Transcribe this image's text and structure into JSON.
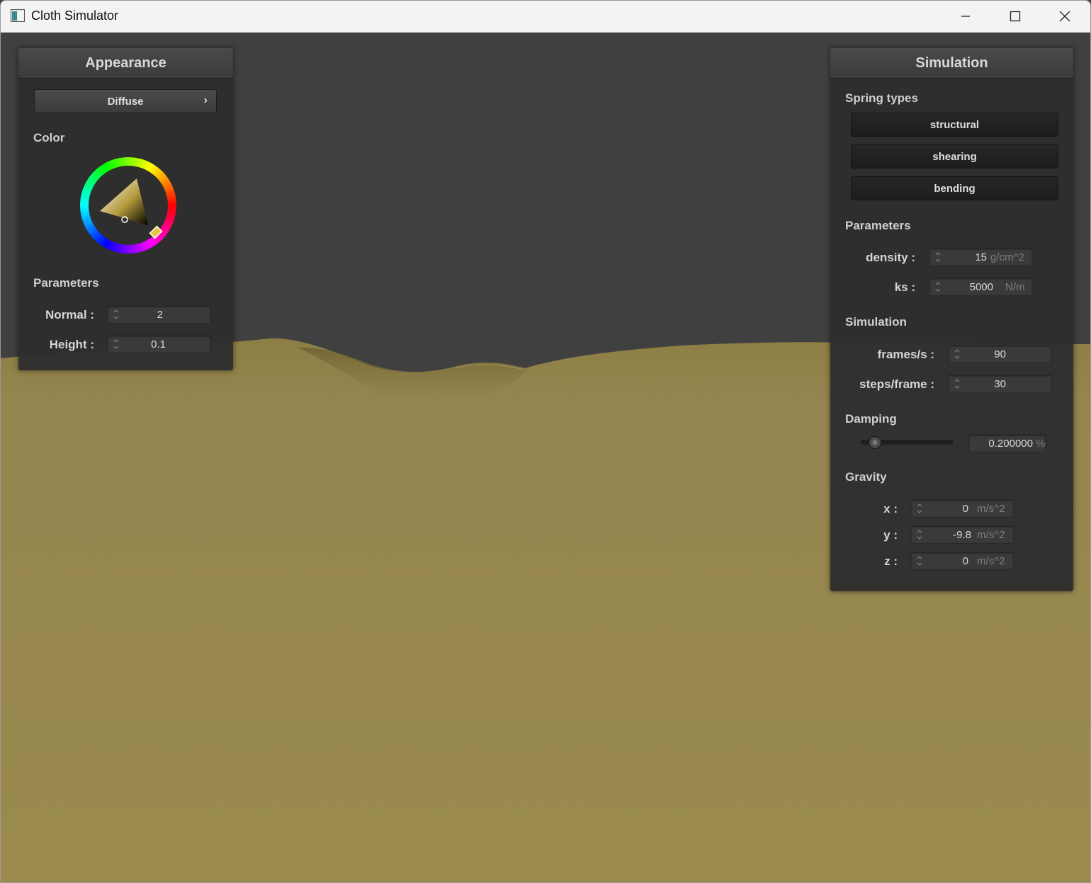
{
  "window": {
    "title": "Cloth Simulator"
  },
  "appearance": {
    "title": "Appearance",
    "shader_dropdown": {
      "value": "Diffuse",
      "arrow": "›"
    },
    "color_label": "Color",
    "color_value": "#9a8a4e",
    "parameters_label": "Parameters",
    "normal": {
      "label": "Normal :",
      "value": "2"
    },
    "height": {
      "label": "Height :",
      "value": "0.1"
    }
  },
  "simulation_panel": {
    "title": "Simulation",
    "spring_types_label": "Spring types",
    "spring_buttons": [
      "structural",
      "shearing",
      "bending"
    ],
    "parameters_label": "Parameters",
    "density": {
      "label": "density :",
      "value": "15",
      "unit": "g/cm^2"
    },
    "ks": {
      "label": "ks :",
      "value": "5000",
      "unit": "N/m"
    },
    "simulation_label": "Simulation",
    "frames_per_s": {
      "label": "frames/s :",
      "value": "90"
    },
    "steps_per_frame": {
      "label": "steps/frame :",
      "value": "30"
    },
    "damping_label": "Damping",
    "damping": {
      "value": "0.200000",
      "unit": "%",
      "slider_fraction": 0.1
    },
    "gravity_label": "Gravity",
    "gravity_x": {
      "label": "x :",
      "value": "0",
      "unit": "m/s^2"
    },
    "gravity_y": {
      "label": "y :",
      "value": "-9.8",
      "unit": "m/s^2"
    },
    "gravity_z": {
      "label": "z :",
      "value": "0",
      "unit": "m/s^2"
    }
  },
  "colors": {
    "background": "#404041",
    "cloth": "#9a8a4e",
    "panel": "#2e2e2f"
  },
  "icons": [
    "app-icon",
    "minimize-icon",
    "maximize-icon",
    "close-icon",
    "spinner-icon",
    "chevron-right-icon"
  ]
}
